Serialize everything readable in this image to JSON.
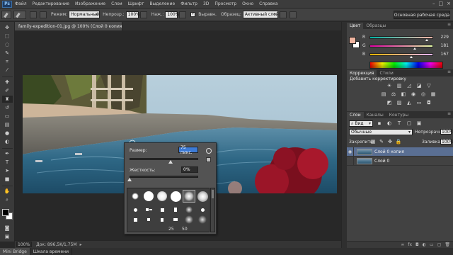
{
  "menu": [
    "Файл",
    "Редактирование",
    "Изображение",
    "Слои",
    "Шрифт",
    "Выделение",
    "Фильтр",
    "3D",
    "Просмотр",
    "Окно",
    "Справка"
  ],
  "app_logo": "Ps",
  "options": {
    "mode_label": "Режим:",
    "mode_value": "Нормальный",
    "opacity_label": "Непрозр.:",
    "opacity_value": "100%",
    "flow_label": "Наж.:",
    "flow_value": "100%",
    "aligned_label": "Выравн.",
    "sample_label": "Образец:",
    "sample_value": "Активный слой",
    "workspace": "Основная рабочая среда"
  },
  "document": {
    "tab_title": "family-expedition-01.jpg @ 100% (Слой 0 копия, RGB/8#) *",
    "close": "×"
  },
  "status": {
    "zoom": "100%",
    "doc_info": "Док: 896,5K/1,75M"
  },
  "bottom_tabs": [
    "Mini Bridge",
    "Шкала времени"
  ],
  "brush_popup": {
    "size_label": "Размер:",
    "size_value": "75 пикс.",
    "hardness_label": "Жесткость:",
    "hardness_value": "0%",
    "size_level": 0.6,
    "hardness_level": 0.0,
    "preset_numbers": [
      "25",
      "50"
    ]
  },
  "color_panel": {
    "tabs": [
      "Цвет",
      "Образцы"
    ],
    "foreground": "#f0b5a0",
    "background": "#ffffff",
    "channels": [
      {
        "label": "R",
        "value": "229",
        "level": 0.9
      },
      {
        "label": "G",
        "value": "181",
        "level": 0.71
      },
      {
        "label": "B",
        "value": "167",
        "level": 0.65
      }
    ]
  },
  "adjust_panel": {
    "tabs": [
      "Коррекция",
      "Стили"
    ],
    "title": "Добавить корректировку"
  },
  "layers_panel": {
    "tabs": [
      "Слои",
      "Каналы",
      "Контуры"
    ],
    "kind_label": "Вид",
    "blend_mode": "Обычные",
    "opacity_label": "Непрозрачность:",
    "opacity_value": "100%",
    "lock_label": "Закрепить:",
    "fill_label": "Заливка:",
    "fill_value": "100%",
    "layers": [
      {
        "name": "Слой 0 копия",
        "selected": true,
        "visible": true
      },
      {
        "name": "Слой 0",
        "selected": false,
        "visible": false
      }
    ]
  }
}
